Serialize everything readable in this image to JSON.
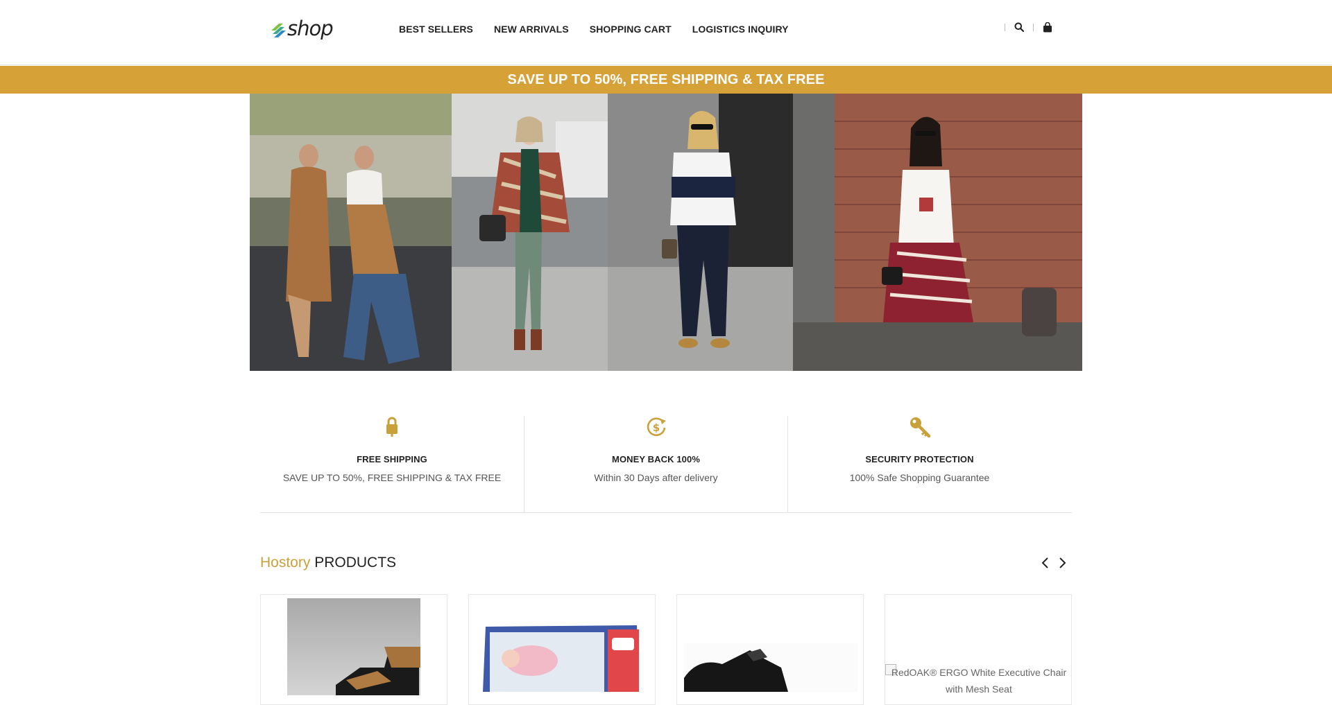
{
  "header": {
    "logo_text": "shop",
    "nav": [
      "BEST SELLERS",
      "NEW ARRIVALS",
      "SHOPPING CART",
      "LOGISTICS INQUIRY"
    ],
    "icons": [
      "search-icon",
      "bag-icon"
    ]
  },
  "promo": {
    "text": "SAVE UP TO 50%, FREE SHIPPING & TAX FREE"
  },
  "features": [
    {
      "icon": "lock-icon",
      "title": "FREE SHIPPING",
      "desc": "SAVE UP TO 50%, FREE SHIPPING & TAX FREE"
    },
    {
      "icon": "money-back-icon",
      "title": "MONEY BACK 100%",
      "desc": "Within 30 Days after delivery"
    },
    {
      "icon": "key-icon",
      "title": "SECURITY PROTECTION",
      "desc": "100% Safe Shopping Guarantee"
    }
  ],
  "products_section": {
    "title_accent": "Hostory",
    "title_rest": " PRODUCTS",
    "products": [
      {
        "kind": "sneaker-high-top"
      },
      {
        "kind": "doll-box"
      },
      {
        "kind": "black-sneaker"
      },
      {
        "kind": "broken-image",
        "alt": "RedOAK® ERGO White Executive Chair with Mesh Seat"
      }
    ]
  },
  "colors": {
    "accent": "#d6a237",
    "accent_text": "#c9a13a",
    "text": "#222222"
  }
}
